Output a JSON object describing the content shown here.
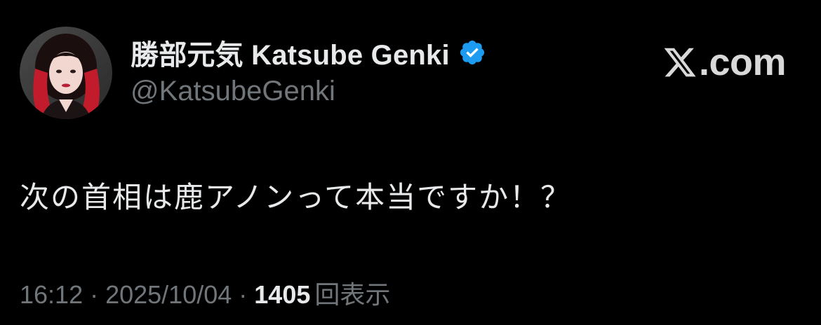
{
  "author": {
    "display_name": "勝部元気 Katsube Genki",
    "handle": "@KatsubeGenki",
    "verified": true
  },
  "brand": {
    "text": ".com",
    "icon": "x-logo-icon"
  },
  "tweet": {
    "text": "次の首相は鹿アノンって本当ですか！？"
  },
  "meta": {
    "time": "16:12",
    "separator": "·",
    "date": "2025/10/04",
    "views_count": "1405",
    "views_label": "回表示"
  },
  "colors": {
    "background": "#000000",
    "primary_text": "#e7e9ea",
    "secondary_text": "#71767b",
    "verified_badge": "#1d9bf0",
    "brand": "#d9d9d9"
  }
}
